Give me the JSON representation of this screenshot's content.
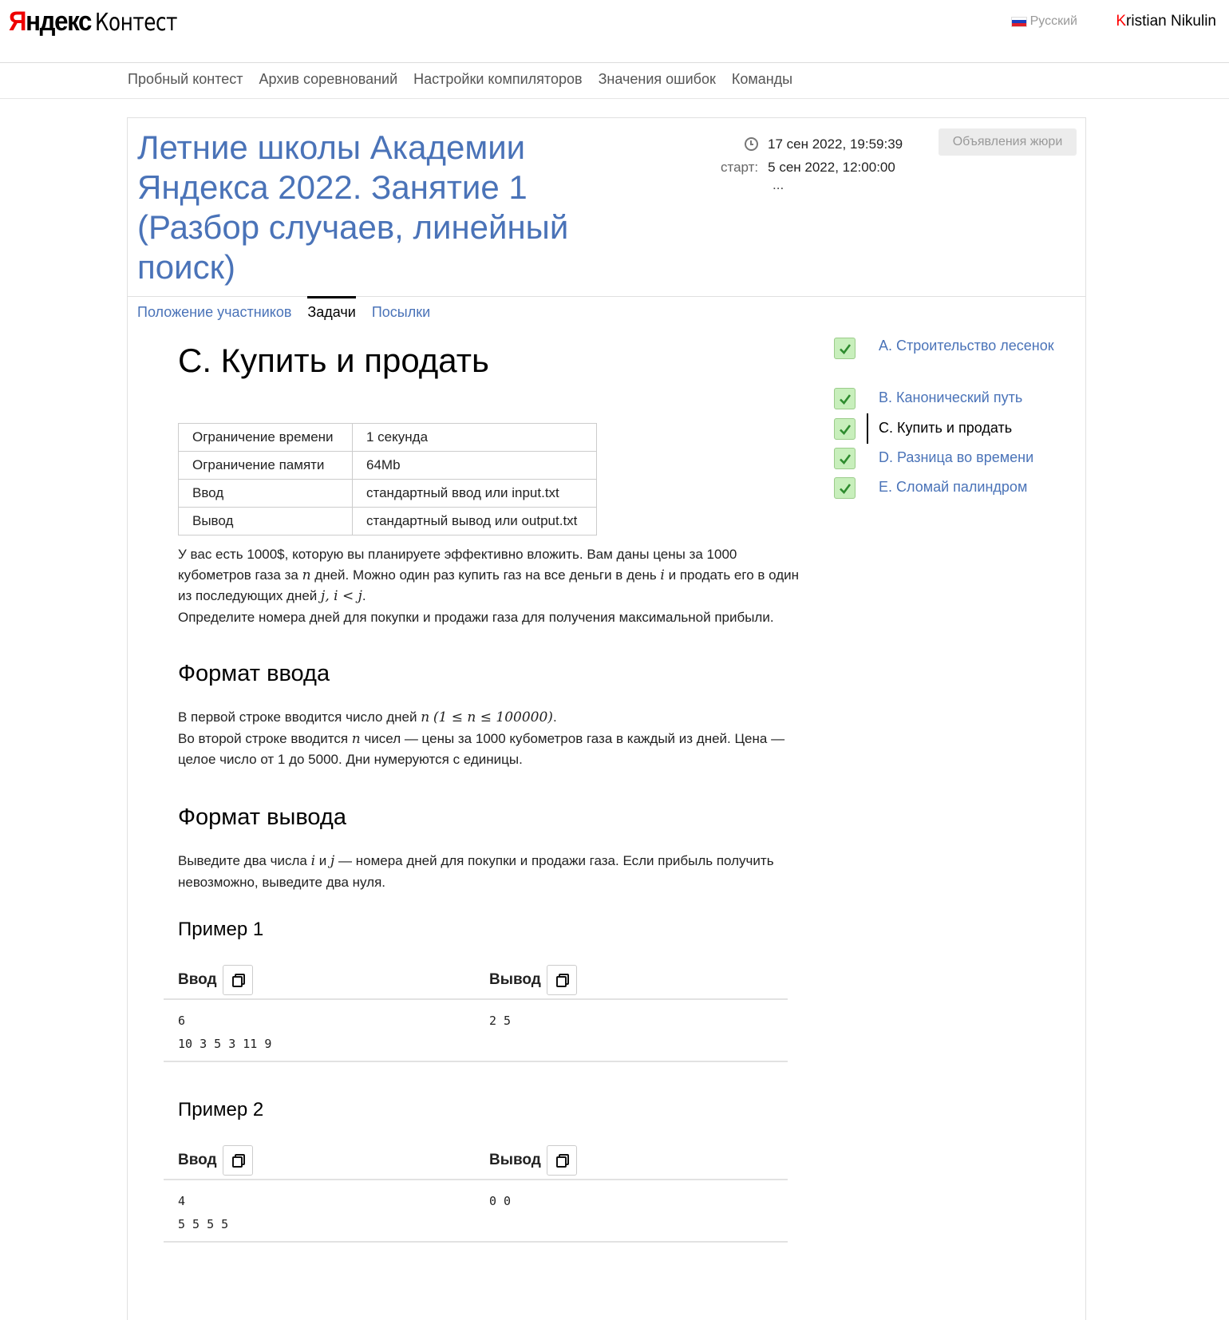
{
  "header": {
    "logo_brand": "Яндекс",
    "logo_product": "Контест",
    "language": "Русский",
    "user_first_letter": "K",
    "user_rest": "ristian Nikulin"
  },
  "nav": [
    "Пробный контест",
    "Архив соревнований",
    "Настройки компиляторов",
    "Значения ошибок",
    "Команды"
  ],
  "contest": {
    "title": "Летние школы Академии Яндекса 2022. Занятие 1 (Разбор случаев, линейный поиск)",
    "now_time": "17 сен 2022, 19:59:39",
    "start_label": "старт:",
    "start_time": "5 сен 2022, 12:00:00",
    "ellipsis": "...",
    "jury_button": "Объявления жюри",
    "tabs": [
      "Положение участников",
      "Задачи",
      "Посылки"
    ],
    "active_tab": "Задачи"
  },
  "problem": {
    "title": "C. Купить и продать",
    "limits": [
      {
        "key": "Ограничение времени",
        "value": "1 секунда"
      },
      {
        "key": "Ограничение памяти",
        "value": "64Mb"
      },
      {
        "key": "Ввод",
        "value": "стандартный ввод или input.txt"
      },
      {
        "key": "Вывод",
        "value": "стандартный вывод или output.txt"
      }
    ],
    "statement": {
      "p1": "У вас есть 1000$, которую вы планируете эффективно вложить. Вам даны цены за 1000 кубометров газа за",
      "n": "n",
      "p2": "дней. Можно один раз купить газ на все деньги в день",
      "i": "i",
      "p3": "и продать его в один из последующих дней",
      "j_cond": "j, i < j",
      "p4": ".",
      "p5": "Определите номера дней для покупки и продажи газа для получения максимальной прибыли."
    },
    "input_format": {
      "title": "Формат ввода",
      "p1": "В первой строке вводится число дней",
      "n": "n",
      "cond": "(1 ≤ n ≤ 100000)",
      "p2": ".",
      "p3": "Во второй строке вводится",
      "n2": "n",
      "p4": "чисел — цены за 1000 кубометров газа в каждый из дней. Цена — целое число от 1 до 5000. Дни нумеруются с единицы."
    },
    "output_format": {
      "title": "Формат вывода",
      "p1": "Выведите два числа",
      "i": "i",
      "and": "и",
      "j": "j",
      "p2": "— номера дней для покупки и продажи газа. Если прибыль получить невозможно, выведите два нуля."
    },
    "examples": [
      {
        "title": "Пример 1",
        "input_label": "Ввод",
        "output_label": "Вывод",
        "input": "6\n10 3 5 3 11 9",
        "output": "2 5"
      },
      {
        "title": "Пример 2",
        "input_label": "Ввод",
        "output_label": "Вывод",
        "input": "4\n5 5 5 5",
        "output": "0 0"
      }
    ]
  },
  "sidebar": {
    "problems": [
      {
        "label": "A. Строительство лесенок",
        "solved": true,
        "current": false
      },
      {
        "label": "B. Канонический путь",
        "solved": true,
        "current": false
      },
      {
        "label": "C. Купить и продать",
        "solved": true,
        "current": true
      },
      {
        "label": "D. Разница во времени",
        "solved": true,
        "current": false
      },
      {
        "label": "E. Сломай палиндром",
        "solved": true,
        "current": false
      }
    ]
  },
  "colors": {
    "link": "#4a73b8",
    "logo_red": "#ee0000",
    "check_bg": "#c8efbc",
    "check_mark": "#2e8b2e"
  }
}
